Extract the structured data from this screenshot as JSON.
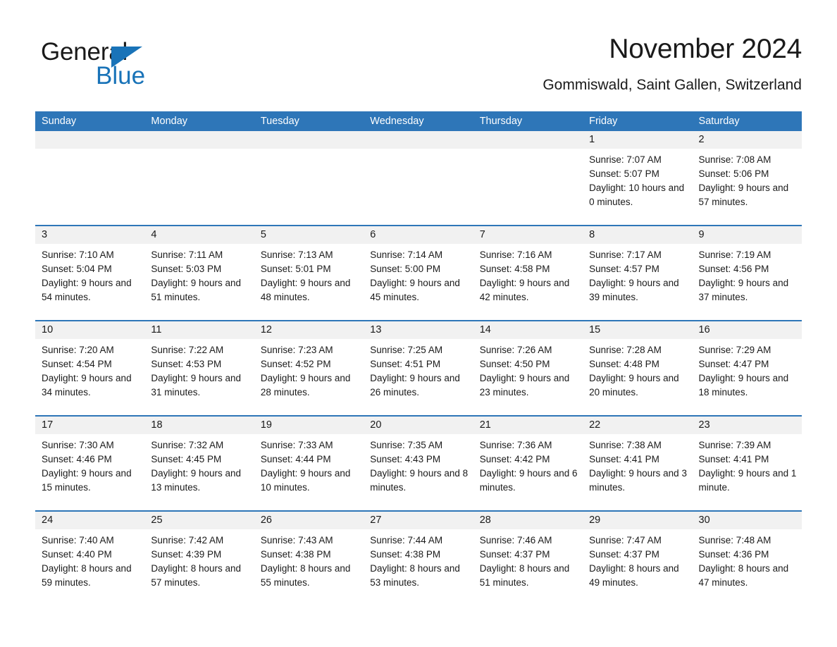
{
  "brand": {
    "name_part1": "General",
    "name_part2": "Blue",
    "accent_color": "#1973b8"
  },
  "header": {
    "title": "November 2024",
    "subtitle": "Gommiswald, Saint Gallen, Switzerland"
  },
  "theme": {
    "header_blue": "#2e76b8",
    "day_band_gray": "#f1f1f1",
    "text_color": "#1a1a1a"
  },
  "weekdays": [
    "Sunday",
    "Monday",
    "Tuesday",
    "Wednesday",
    "Thursday",
    "Friday",
    "Saturday"
  ],
  "weeks": [
    [
      {
        "day": "",
        "sunrise": "",
        "sunset": "",
        "daylight": ""
      },
      {
        "day": "",
        "sunrise": "",
        "sunset": "",
        "daylight": ""
      },
      {
        "day": "",
        "sunrise": "",
        "sunset": "",
        "daylight": ""
      },
      {
        "day": "",
        "sunrise": "",
        "sunset": "",
        "daylight": ""
      },
      {
        "day": "",
        "sunrise": "",
        "sunset": "",
        "daylight": ""
      },
      {
        "day": "1",
        "sunrise": "Sunrise: 7:07 AM",
        "sunset": "Sunset: 5:07 PM",
        "daylight": "Daylight: 10 hours and 0 minutes."
      },
      {
        "day": "2",
        "sunrise": "Sunrise: 7:08 AM",
        "sunset": "Sunset: 5:06 PM",
        "daylight": "Daylight: 9 hours and 57 minutes."
      }
    ],
    [
      {
        "day": "3",
        "sunrise": "Sunrise: 7:10 AM",
        "sunset": "Sunset: 5:04 PM",
        "daylight": "Daylight: 9 hours and 54 minutes."
      },
      {
        "day": "4",
        "sunrise": "Sunrise: 7:11 AM",
        "sunset": "Sunset: 5:03 PM",
        "daylight": "Daylight: 9 hours and 51 minutes."
      },
      {
        "day": "5",
        "sunrise": "Sunrise: 7:13 AM",
        "sunset": "Sunset: 5:01 PM",
        "daylight": "Daylight: 9 hours and 48 minutes."
      },
      {
        "day": "6",
        "sunrise": "Sunrise: 7:14 AM",
        "sunset": "Sunset: 5:00 PM",
        "daylight": "Daylight: 9 hours and 45 minutes."
      },
      {
        "day": "7",
        "sunrise": "Sunrise: 7:16 AM",
        "sunset": "Sunset: 4:58 PM",
        "daylight": "Daylight: 9 hours and 42 minutes."
      },
      {
        "day": "8",
        "sunrise": "Sunrise: 7:17 AM",
        "sunset": "Sunset: 4:57 PM",
        "daylight": "Daylight: 9 hours and 39 minutes."
      },
      {
        "day": "9",
        "sunrise": "Sunrise: 7:19 AM",
        "sunset": "Sunset: 4:56 PM",
        "daylight": "Daylight: 9 hours and 37 minutes."
      }
    ],
    [
      {
        "day": "10",
        "sunrise": "Sunrise: 7:20 AM",
        "sunset": "Sunset: 4:54 PM",
        "daylight": "Daylight: 9 hours and 34 minutes."
      },
      {
        "day": "11",
        "sunrise": "Sunrise: 7:22 AM",
        "sunset": "Sunset: 4:53 PM",
        "daylight": "Daylight: 9 hours and 31 minutes."
      },
      {
        "day": "12",
        "sunrise": "Sunrise: 7:23 AM",
        "sunset": "Sunset: 4:52 PM",
        "daylight": "Daylight: 9 hours and 28 minutes."
      },
      {
        "day": "13",
        "sunrise": "Sunrise: 7:25 AM",
        "sunset": "Sunset: 4:51 PM",
        "daylight": "Daylight: 9 hours and 26 minutes."
      },
      {
        "day": "14",
        "sunrise": "Sunrise: 7:26 AM",
        "sunset": "Sunset: 4:50 PM",
        "daylight": "Daylight: 9 hours and 23 minutes."
      },
      {
        "day": "15",
        "sunrise": "Sunrise: 7:28 AM",
        "sunset": "Sunset: 4:48 PM",
        "daylight": "Daylight: 9 hours and 20 minutes."
      },
      {
        "day": "16",
        "sunrise": "Sunrise: 7:29 AM",
        "sunset": "Sunset: 4:47 PM",
        "daylight": "Daylight: 9 hours and 18 minutes."
      }
    ],
    [
      {
        "day": "17",
        "sunrise": "Sunrise: 7:30 AM",
        "sunset": "Sunset: 4:46 PM",
        "daylight": "Daylight: 9 hours and 15 minutes."
      },
      {
        "day": "18",
        "sunrise": "Sunrise: 7:32 AM",
        "sunset": "Sunset: 4:45 PM",
        "daylight": "Daylight: 9 hours and 13 minutes."
      },
      {
        "day": "19",
        "sunrise": "Sunrise: 7:33 AM",
        "sunset": "Sunset: 4:44 PM",
        "daylight": "Daylight: 9 hours and 10 minutes."
      },
      {
        "day": "20",
        "sunrise": "Sunrise: 7:35 AM",
        "sunset": "Sunset: 4:43 PM",
        "daylight": "Daylight: 9 hours and 8 minutes."
      },
      {
        "day": "21",
        "sunrise": "Sunrise: 7:36 AM",
        "sunset": "Sunset: 4:42 PM",
        "daylight": "Daylight: 9 hours and 6 minutes."
      },
      {
        "day": "22",
        "sunrise": "Sunrise: 7:38 AM",
        "sunset": "Sunset: 4:41 PM",
        "daylight": "Daylight: 9 hours and 3 minutes."
      },
      {
        "day": "23",
        "sunrise": "Sunrise: 7:39 AM",
        "sunset": "Sunset: 4:41 PM",
        "daylight": "Daylight: 9 hours and 1 minute."
      }
    ],
    [
      {
        "day": "24",
        "sunrise": "Sunrise: 7:40 AM",
        "sunset": "Sunset: 4:40 PM",
        "daylight": "Daylight: 8 hours and 59 minutes."
      },
      {
        "day": "25",
        "sunrise": "Sunrise: 7:42 AM",
        "sunset": "Sunset: 4:39 PM",
        "daylight": "Daylight: 8 hours and 57 minutes."
      },
      {
        "day": "26",
        "sunrise": "Sunrise: 7:43 AM",
        "sunset": "Sunset: 4:38 PM",
        "daylight": "Daylight: 8 hours and 55 minutes."
      },
      {
        "day": "27",
        "sunrise": "Sunrise: 7:44 AM",
        "sunset": "Sunset: 4:38 PM",
        "daylight": "Daylight: 8 hours and 53 minutes."
      },
      {
        "day": "28",
        "sunrise": "Sunrise: 7:46 AM",
        "sunset": "Sunset: 4:37 PM",
        "daylight": "Daylight: 8 hours and 51 minutes."
      },
      {
        "day": "29",
        "sunrise": "Sunrise: 7:47 AM",
        "sunset": "Sunset: 4:37 PM",
        "daylight": "Daylight: 8 hours and 49 minutes."
      },
      {
        "day": "30",
        "sunrise": "Sunrise: 7:48 AM",
        "sunset": "Sunset: 4:36 PM",
        "daylight": "Daylight: 8 hours and 47 minutes."
      }
    ]
  ]
}
